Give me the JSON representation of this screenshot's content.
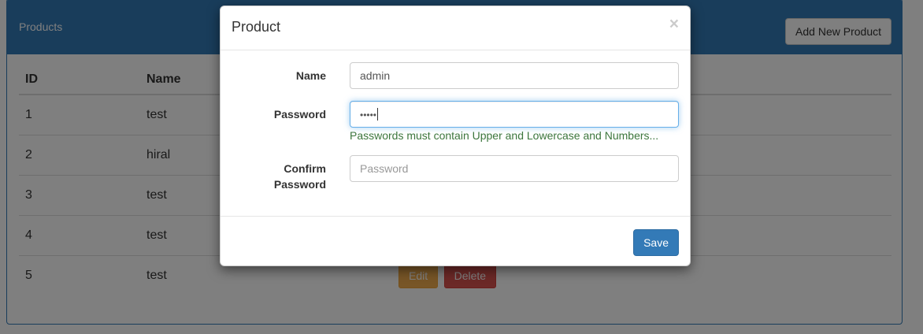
{
  "panel": {
    "title": "Products",
    "add_button_label": "Add New Product"
  },
  "table": {
    "headers": {
      "id": "ID",
      "name": "Name"
    },
    "rows": [
      {
        "id": "1",
        "name": "test"
      },
      {
        "id": "2",
        "name": "hiral"
      },
      {
        "id": "3",
        "name": "test"
      },
      {
        "id": "4",
        "name": "test"
      },
      {
        "id": "5",
        "name": "test"
      }
    ],
    "edit_label": "Edit",
    "delete_label": "Delete"
  },
  "modal": {
    "title": "Product",
    "close_glyph": "×",
    "name_label": "Name",
    "name_value": "admin",
    "password_label": "Password",
    "password_masked": "•••••",
    "password_help": "Passwords must contain Upper and Lowercase and Numbers...",
    "confirm_label_line1": "Confirm",
    "confirm_label_line2": "Password",
    "confirm_placeholder": "Password",
    "save_label": "Save"
  },
  "colors": {
    "primary": "#337ab7",
    "warning": "#f0ad4e",
    "danger": "#d9534f",
    "success_text": "#3c763d"
  }
}
